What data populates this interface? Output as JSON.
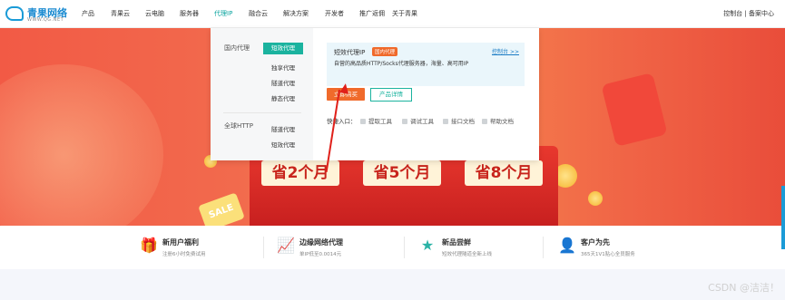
{
  "brand": {
    "name": "青果网络",
    "url": "WWW.QG.NET",
    "accent": "#1bb39f",
    "orange": "#f06a2b"
  },
  "nav": {
    "items": [
      "产品",
      "青果云",
      "云电脑",
      "服务器",
      "代理IP",
      "融合云",
      "解决方案",
      "开发者",
      "推广返佣",
      "关于青果"
    ],
    "active": "代理IP",
    "right": "控制台 | 备案中心"
  },
  "banner": {
    "save_labels": [
      "省2个月",
      "省5个月",
      "省8个月"
    ],
    "sale": "SALE"
  },
  "dropdown": {
    "categories": [
      {
        "label": "国内代理",
        "items": [
          "短效代理",
          "独享代理",
          "隧道代理",
          "静态代理"
        ]
      },
      {
        "label": "全球HTTP",
        "items": [
          "隧道代理",
          "短效代理"
        ]
      }
    ],
    "card": {
      "title": "短效代理IP",
      "badge": "国内代理",
      "desc": "自营的高品质HTTP/Socks代理服务器，海量、高可用IP",
      "link": "控制台 >>"
    },
    "buy_label": "立即购买",
    "detail_label": "产品详情",
    "quick_entry_label": "快捷入口：",
    "quick_entries": [
      "提取工具",
      "调试工具",
      "接口文档",
      "帮助文档"
    ]
  },
  "features": [
    {
      "title": "新用户福利",
      "sub": "注册6小时免费试用",
      "icon": "gift-icon"
    },
    {
      "title": "边缘网络代理",
      "sub": "单IP低至0.0014元",
      "icon": "network-proxy-icon"
    },
    {
      "title": "新品尝鲜",
      "sub": "短效代理隧道全新上线",
      "icon": "new-product-icon"
    },
    {
      "title": "客户为先",
      "sub": "365天1V1贴心全员服务",
      "icon": "customer-icon"
    }
  ],
  "watermark": "CSDN @洁洁！"
}
